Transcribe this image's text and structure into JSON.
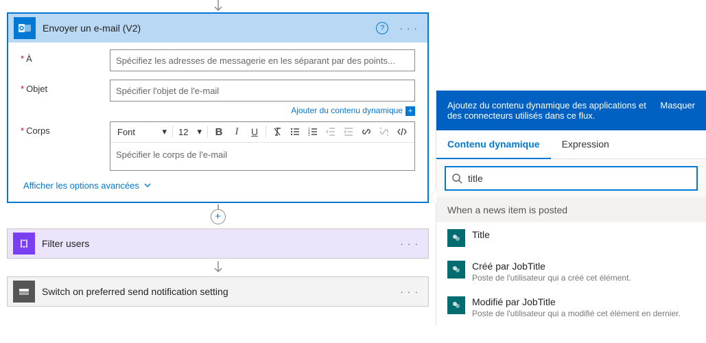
{
  "email_card": {
    "title": "Envoyer un e-mail (V2)",
    "to_label": "À",
    "to_placeholder": "Spécifiez les adresses de messagerie en les séparant par des points...",
    "subject_label": "Objet",
    "subject_placeholder": "Spécifier l'objet de l'e-mail",
    "dynamic_link": "Ajouter du contenu dynamique",
    "body_label": "Corps",
    "body_placeholder": "Spécifier le corps de l'e-mail",
    "font_label": "Font",
    "font_size": "12",
    "advanced_link": "Afficher les options avancées"
  },
  "filter_card": {
    "title": "Filter users"
  },
  "switch_card": {
    "title": "Switch on preferred send notification setting"
  },
  "panel": {
    "header_line1": "Ajoutez du contenu dynamique des applications et",
    "header_line2": "des connecteurs utilisés dans ce flux.",
    "hide": "Masquer",
    "tab_dynamic": "Contenu dynamique",
    "tab_expression": "Expression",
    "search_value": "title",
    "group": "When a news item is posted",
    "tokens": [
      {
        "title": "Title",
        "desc": ""
      },
      {
        "title": "Créé par JobTitle",
        "desc": "Poste de l'utilisateur qui a créé cet élément."
      },
      {
        "title": "Modifié par JobTitle",
        "desc": "Poste de l'utilisateur qui a modifié cet élément en dernier."
      }
    ]
  }
}
